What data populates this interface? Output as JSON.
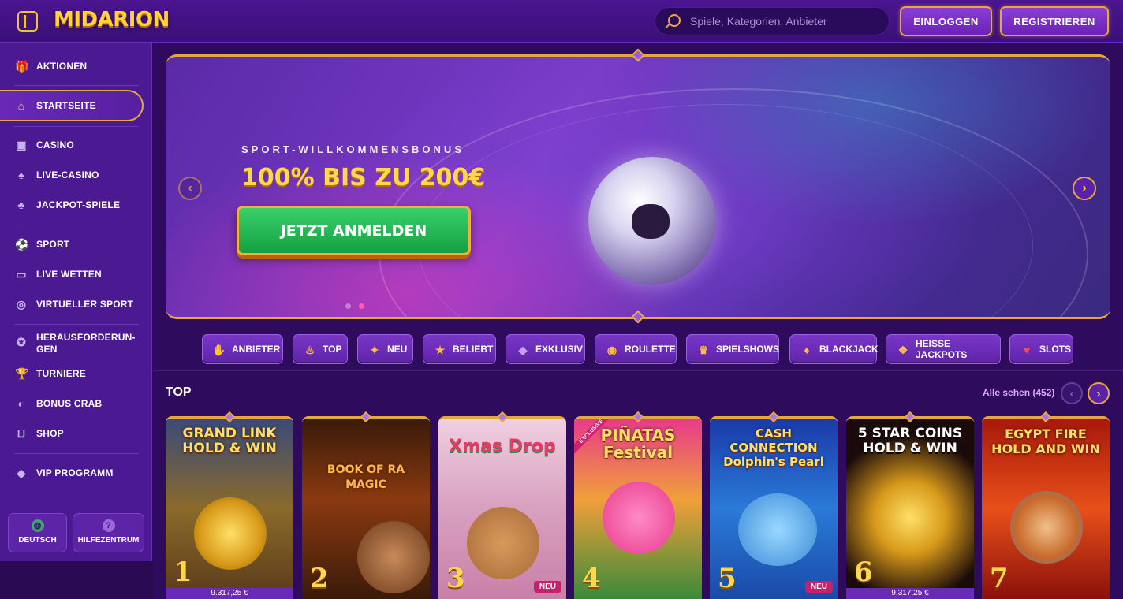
{
  "header": {
    "logo": "MIDARION",
    "search_placeholder": "Spiele, Kategorien, Anbieter",
    "login_label": "EINLOGGEN",
    "register_label": "REGISTRIEREN"
  },
  "sidebar": {
    "items": [
      {
        "label": "AKTIONEN",
        "icon": "gift-icon"
      },
      {
        "label": "STARTSEITE",
        "icon": "home-icon"
      },
      {
        "label": "CASINO",
        "icon": "slot-machine-icon"
      },
      {
        "label": "LIVE-CASINO",
        "icon": "cards-icon"
      },
      {
        "label": "JACKPOT-SPIELE",
        "icon": "clover-icon"
      },
      {
        "label": "SPORT",
        "icon": "ball-icon"
      },
      {
        "label": "LIVE WETTEN",
        "icon": "live-icon"
      },
      {
        "label": "VIRTUELLER SPORT",
        "icon": "gamepad-icon"
      },
      {
        "label": "HERAUSFORDERUN-GEN",
        "icon": "medal-icon"
      },
      {
        "label": "TURNIERE",
        "icon": "trophy-icon"
      },
      {
        "label": "BONUS CRAB",
        "icon": "crab-icon"
      },
      {
        "label": "SHOP",
        "icon": "basket-icon"
      },
      {
        "label": "VIP PROGRAMM",
        "icon": "diamond-icon"
      }
    ],
    "language_label": "DEUTSCH",
    "help_label": "HILFEZENTRUM"
  },
  "hero": {
    "subtitle": "SPORT-WILLKOMMENSBONUS",
    "title": "100% BIS ZU 200€",
    "cta": "JETZT ANMELDEN"
  },
  "categories": [
    {
      "label": "ANBIETER",
      "icon": "provider-icon"
    },
    {
      "label": "TOP",
      "icon": "fire-icon"
    },
    {
      "label": "NEU",
      "icon": "new-icon"
    },
    {
      "label": "BELIEBT",
      "icon": "star-icon"
    },
    {
      "label": "EXKLUSIV",
      "icon": "gem-icon"
    },
    {
      "label": "ROULETTE",
      "icon": "roulette-icon"
    },
    {
      "label": "SPIELSHOWS",
      "icon": "show-icon"
    },
    {
      "label": "BLACKJACK",
      "icon": "chips-icon"
    },
    {
      "label": "HEISSE JACKPOTS",
      "icon": "jackpot-icon"
    },
    {
      "label": "SLOTS",
      "icon": "cherry-icon"
    }
  ],
  "top_section": {
    "title": "TOP",
    "see_all": "Alle sehen (452)",
    "games": [
      {
        "title": "GRAND LINK HOLD & WIN",
        "rank": "1",
        "price": "9.317,25 €",
        "badge": ""
      },
      {
        "title": "BOOK OF RA MAGIC",
        "rank": "2",
        "price": "",
        "badge": ""
      },
      {
        "title": "Xmas Drop",
        "rank": "3",
        "price": "",
        "badge": "NEU"
      },
      {
        "title": "PIÑATAS Festival",
        "rank": "4",
        "price": "",
        "badge": ""
      },
      {
        "title": "CASH CONNECTION Dolphin's Pearl",
        "rank": "5",
        "price": "",
        "badge": "NEU"
      },
      {
        "title": "5 STAR COINS HOLD & WIN",
        "rank": "6",
        "price": "9.317,25 €",
        "badge": ""
      },
      {
        "title": "EGYPT FIRE HOLD AND WIN",
        "rank": "7",
        "price": "",
        "badge": ""
      }
    ]
  }
}
